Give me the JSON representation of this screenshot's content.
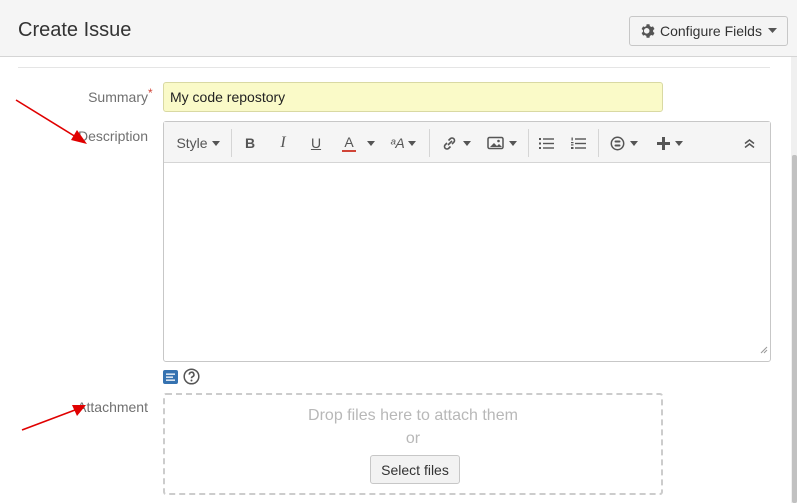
{
  "dialog": {
    "title": "Create Issue",
    "configure_label": "Configure Fields"
  },
  "summary": {
    "label": "Summary",
    "required_marker": "*",
    "value": "My code repostory"
  },
  "description": {
    "label": "Description",
    "toolbar": {
      "style_label": "Style",
      "bold": "B",
      "italic": "I",
      "underline": "U",
      "text_color": "A",
      "more_formatting": "ᵃA"
    },
    "value": ""
  },
  "attachment": {
    "label": "Attachment",
    "drop_text": "Drop files here to attach them",
    "or_text": "or",
    "select_files_label": "Select files"
  },
  "colors": {
    "summary_bg": "#fafac8",
    "annotation_arrow": "#e00000",
    "text_color_underline": "#d04437",
    "mode_icon": "#3572b0"
  }
}
